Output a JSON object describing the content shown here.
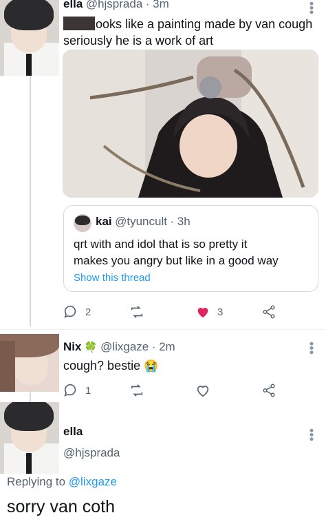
{
  "tweet1": {
    "name": "ella",
    "handle": "@hjsprada",
    "time": "· 3m",
    "text_line1": "ooks like a painting made by van cough",
    "text_line2": "seriously he is a work of art",
    "quote": {
      "name": "kai",
      "handle": "@tyuncult",
      "time": "· 3h",
      "text_line1": "qrt with and idol that is so pretty it",
      "text_line2": "makes you angry but like in a good way",
      "show_thread": "Show this thread"
    },
    "actions": {
      "replies": "2",
      "likes": "3",
      "like_color": "#e0245e"
    }
  },
  "tweet2": {
    "name": "Nix",
    "name_emoji": "🍀",
    "handle": "@lixgaze",
    "time": "· 2m",
    "text": "cough? bestie",
    "text_emoji": "😭",
    "actions": {
      "replies": "1"
    }
  },
  "tweet3": {
    "name": "ella",
    "handle": "@hjsprada",
    "replying_prefix": "Replying to",
    "replying_to": "@lixgaze",
    "text": "sorry van coth"
  },
  "colors": {
    "accent": "#1d9bf0",
    "muted": "#536471",
    "line": "#cfd9de"
  }
}
